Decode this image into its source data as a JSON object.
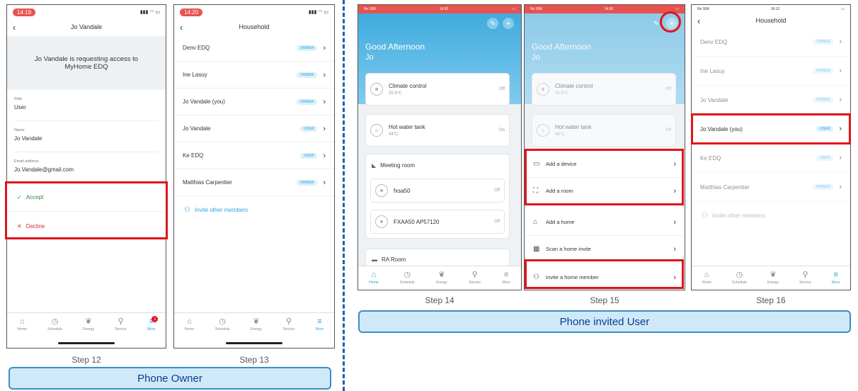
{
  "phone12": {
    "time": "14:19",
    "title": "Jo Vandale",
    "message": "Jo Vandale is requesting access to MyHome EDQ",
    "role_label": "Role",
    "role_value": "User",
    "name_label": "Name",
    "name_value": "Jo Vandale",
    "email_label": "Email address",
    "email_value": "Jo.Vandale@gmail.com",
    "accept": "Accept",
    "decline": "Decline",
    "step": "Step 12"
  },
  "phone13": {
    "time": "14:20",
    "title": "Household",
    "members": [
      {
        "name": "Denv EDQ",
        "badge": "OWNER"
      },
      {
        "name": "Ine Lasuy",
        "badge": "OWNER"
      },
      {
        "name": "Jo Vandale (you)",
        "badge": "OWNER"
      },
      {
        "name": "Jo Vandale",
        "badge": "USER"
      },
      {
        "name": "Ke EDQ",
        "badge": "USER"
      },
      {
        "name": "Matthias Carpentier",
        "badge": "OWNER"
      }
    ],
    "invite": "Invite other members",
    "step": "Step 13"
  },
  "phone14": {
    "carrier": "No SIM",
    "time": "14:30",
    "greeting": "Good Afternoon",
    "user": "Jo",
    "climate_name": "Climate control",
    "climate_temp": "25.9°C",
    "climate_state": "Off",
    "tank_name": "Hot water tank",
    "tank_temp": "44°C",
    "tank_state": "On",
    "room_name": "Meeting room",
    "unit1": "fxsa50",
    "unit1_state": "Off",
    "unit2": "FXAA50 AP57120",
    "unit2_state": "Off",
    "room2_name": "RA Room",
    "step": "Step 14"
  },
  "phone15": {
    "carrier": "No SIM",
    "time": "14:30",
    "greeting": "Good Afternoon",
    "user": "Jo",
    "climate_name": "Climate control",
    "climate_temp": "25.9°C",
    "climate_state": "Off",
    "tank_name": "Hot water tank",
    "tank_temp": "44°C",
    "tank_state": "Off",
    "menu": [
      "Add a device",
      "Add a room",
      "Add a home",
      "Scan a home invite",
      "Invite a home member"
    ],
    "step": "Step 15"
  },
  "phone16": {
    "carrier": "No SIM",
    "time": "16:12",
    "title": "Household",
    "members": [
      {
        "name": "Denv EDQ",
        "badge": "OWNER"
      },
      {
        "name": "Ine Lasuy",
        "badge": "OWNER"
      },
      {
        "name": "Jo Vandale",
        "badge": "OWNER"
      },
      {
        "name": "Jo Vandale (you)",
        "badge": "USER"
      },
      {
        "name": "Ke EDQ",
        "badge": "USER"
      },
      {
        "name": "Matthias Carpentier",
        "badge": "OWNER"
      }
    ],
    "invite": "Invite other members",
    "step": "Step 16"
  },
  "tabs": [
    "Home",
    "Schedule",
    "Energy",
    "Service",
    "More"
  ],
  "tab_icons": [
    "home-icon",
    "clock-icon",
    "leaf-icon",
    "wrench-icon",
    "menu-icon"
  ],
  "notification_count": "1",
  "banners": {
    "owner": "Phone Owner",
    "invited": "Phone invited User"
  },
  "colors": {
    "accent": "#2aa3dd",
    "highlight": "#e0141b",
    "banner_bg": "#cfe9f8",
    "banner_border": "#3b8ec4",
    "divider": "#1e5fae"
  }
}
